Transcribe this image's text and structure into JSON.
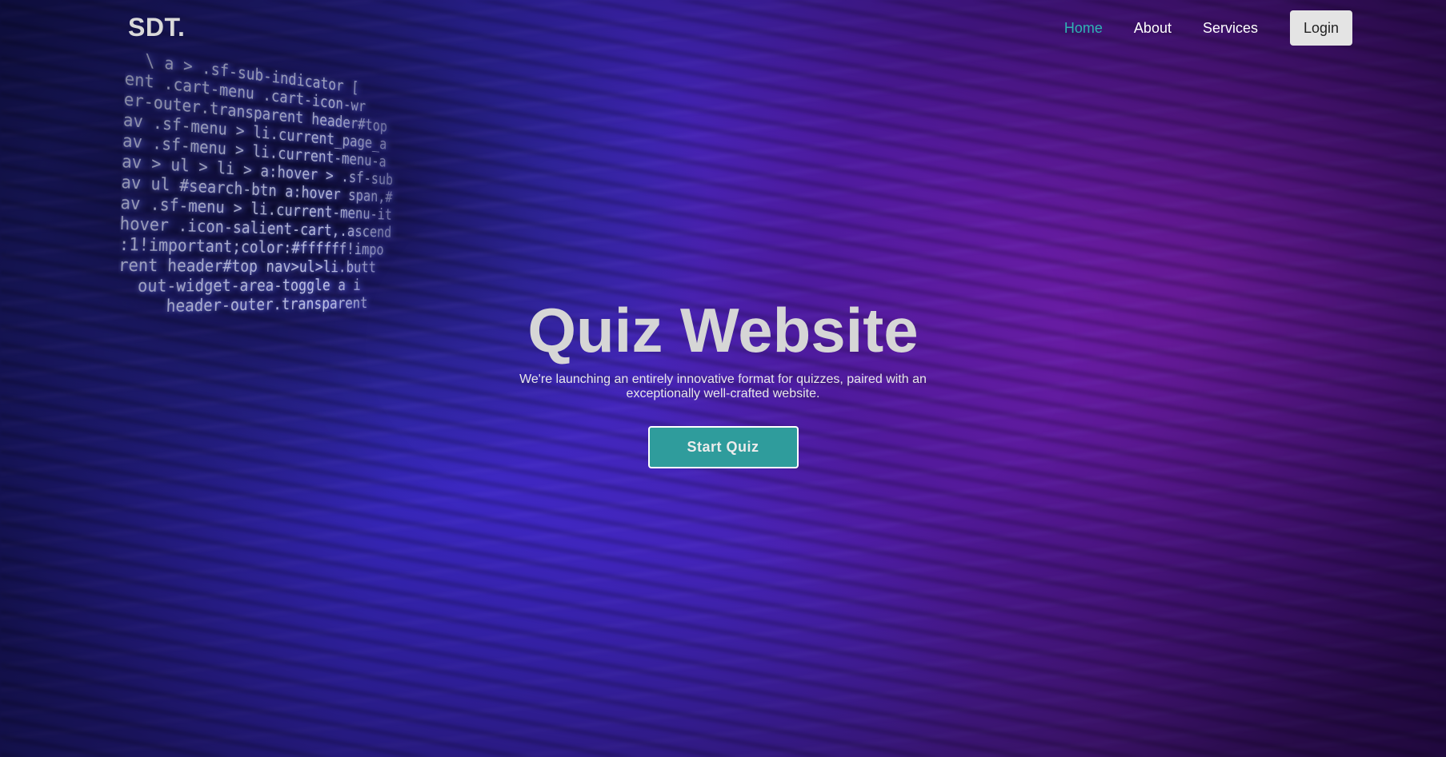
{
  "brand": {
    "logo_text": "SDT."
  },
  "nav": {
    "items": [
      {
        "label": "Home",
        "active": true
      },
      {
        "label": "About",
        "active": false
      },
      {
        "label": "Services",
        "active": false
      }
    ],
    "login_label": "Login"
  },
  "hero": {
    "title": "Quiz Website",
    "subtitle": "We're launching an entirely innovative format for quizzes, paired with an exceptionally well-crafted website.",
    "cta_label": "Start Quiz"
  },
  "background_code": [
    "  \\ a > .sf-sub-indicator [",
    "ent .cart-menu .cart-icon-wr",
    "er-outer.transparent header#top",
    "av .sf-menu > li.current_page_a",
    "av .sf-menu > li.current-menu-a",
    "av > ul > li > a:hover > .sf-sub",
    "av ul #search-btn a:hover span,#",
    "av .sf-menu > li.current-menu-it",
    "hover .icon-salient-cart,.ascend",
    ":1!important;color:#ffffff!impo",
    "rent header#top nav>ul>li.butt",
    "  out-widget-area-toggle a i",
    "     header-outer.transparent"
  ],
  "colors": {
    "accent": "#2fb3b3",
    "cta_background": "#2f9c9c",
    "background_primary": "#3a2ac4",
    "background_secondary": "#5a1c9e"
  }
}
